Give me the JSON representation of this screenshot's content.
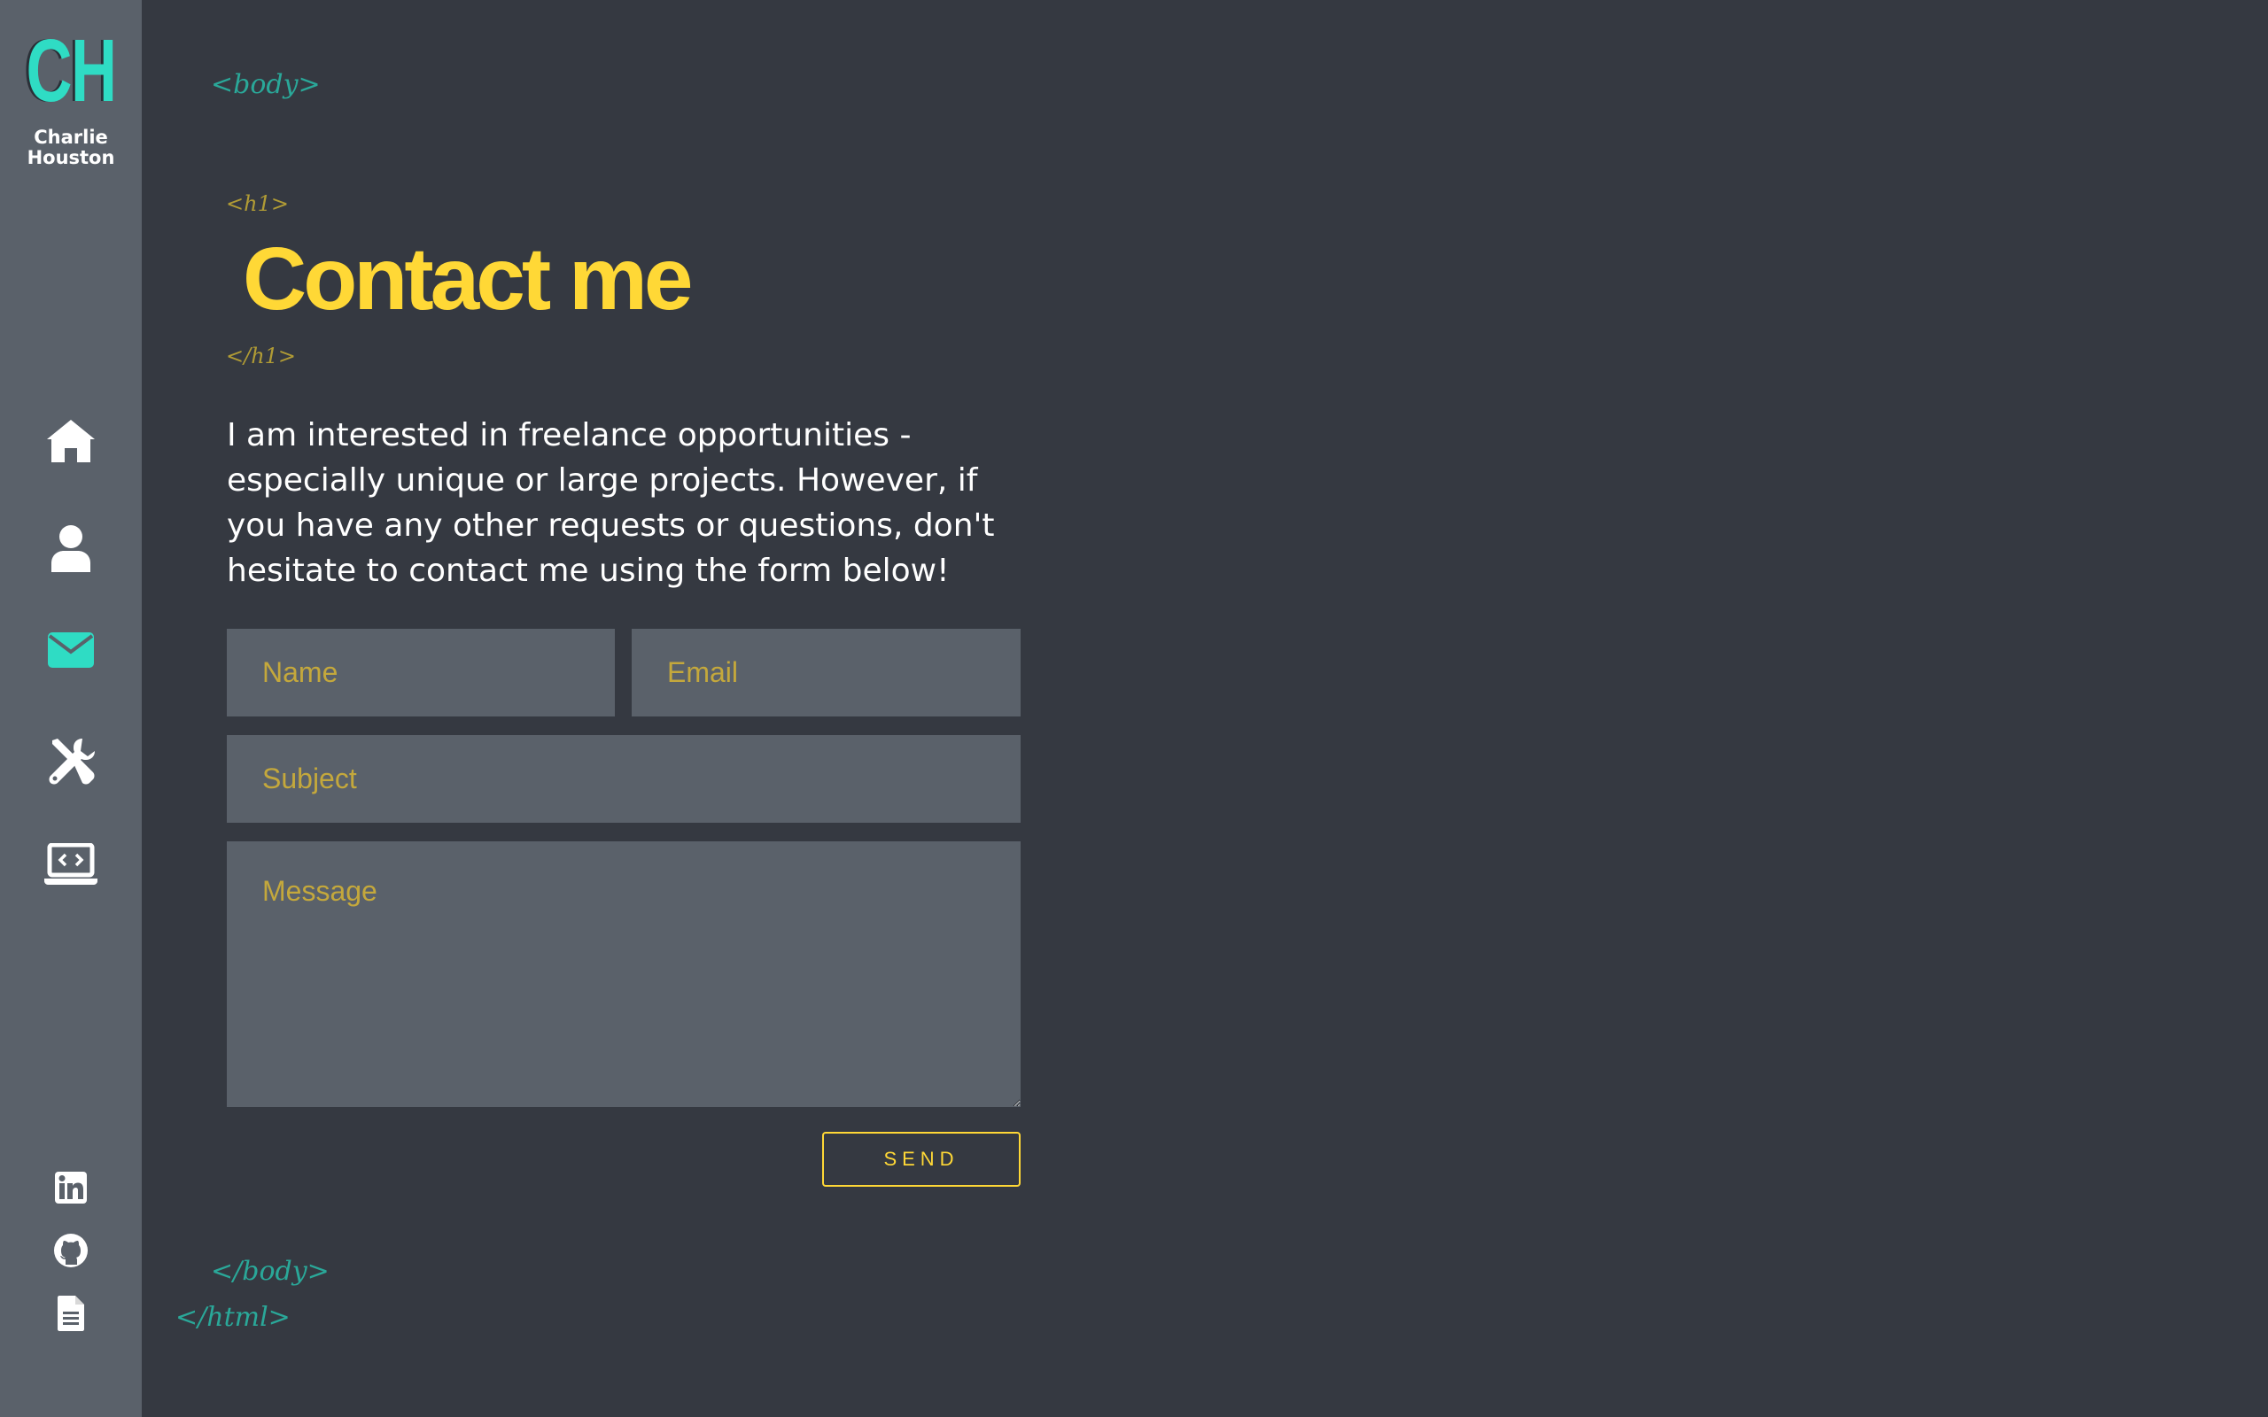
{
  "brand": {
    "logo_initials": "CH",
    "name_line1": "Charlie",
    "name_line2": "Houston",
    "accent_color": "#2fdcc4"
  },
  "sidebar": {
    "nav_items": [
      {
        "icon": "home-icon",
        "active": false
      },
      {
        "icon": "user-icon",
        "active": false
      },
      {
        "icon": "envelope-icon",
        "active": true
      },
      {
        "icon": "tools-icon",
        "active": false
      },
      {
        "icon": "laptop-code-icon",
        "active": false
      }
    ],
    "social_items": [
      {
        "icon": "linkedin-icon"
      },
      {
        "icon": "github-icon"
      },
      {
        "icon": "document-icon"
      }
    ]
  },
  "code_tags": {
    "body_open": "<body>",
    "h1_open": "<h1>",
    "h1_close": "</h1>",
    "body_close": "</body>",
    "html_close": "</html>"
  },
  "main": {
    "title": "Contact me",
    "intro": "I am interested in freelance opportunities - especially unique or large projects. However, if you have any other requests or questions, don't hesitate to contact me using the form below!"
  },
  "form": {
    "name_placeholder": "Name",
    "email_placeholder": "Email",
    "subject_placeholder": "Subject",
    "message_placeholder": "Message",
    "send_label": "SEND"
  },
  "colors": {
    "background": "#353941",
    "sidebar": "#5a616a",
    "title": "#ffd836",
    "tag_teal": "#2aa899",
    "tag_gold": "#b09b35"
  }
}
